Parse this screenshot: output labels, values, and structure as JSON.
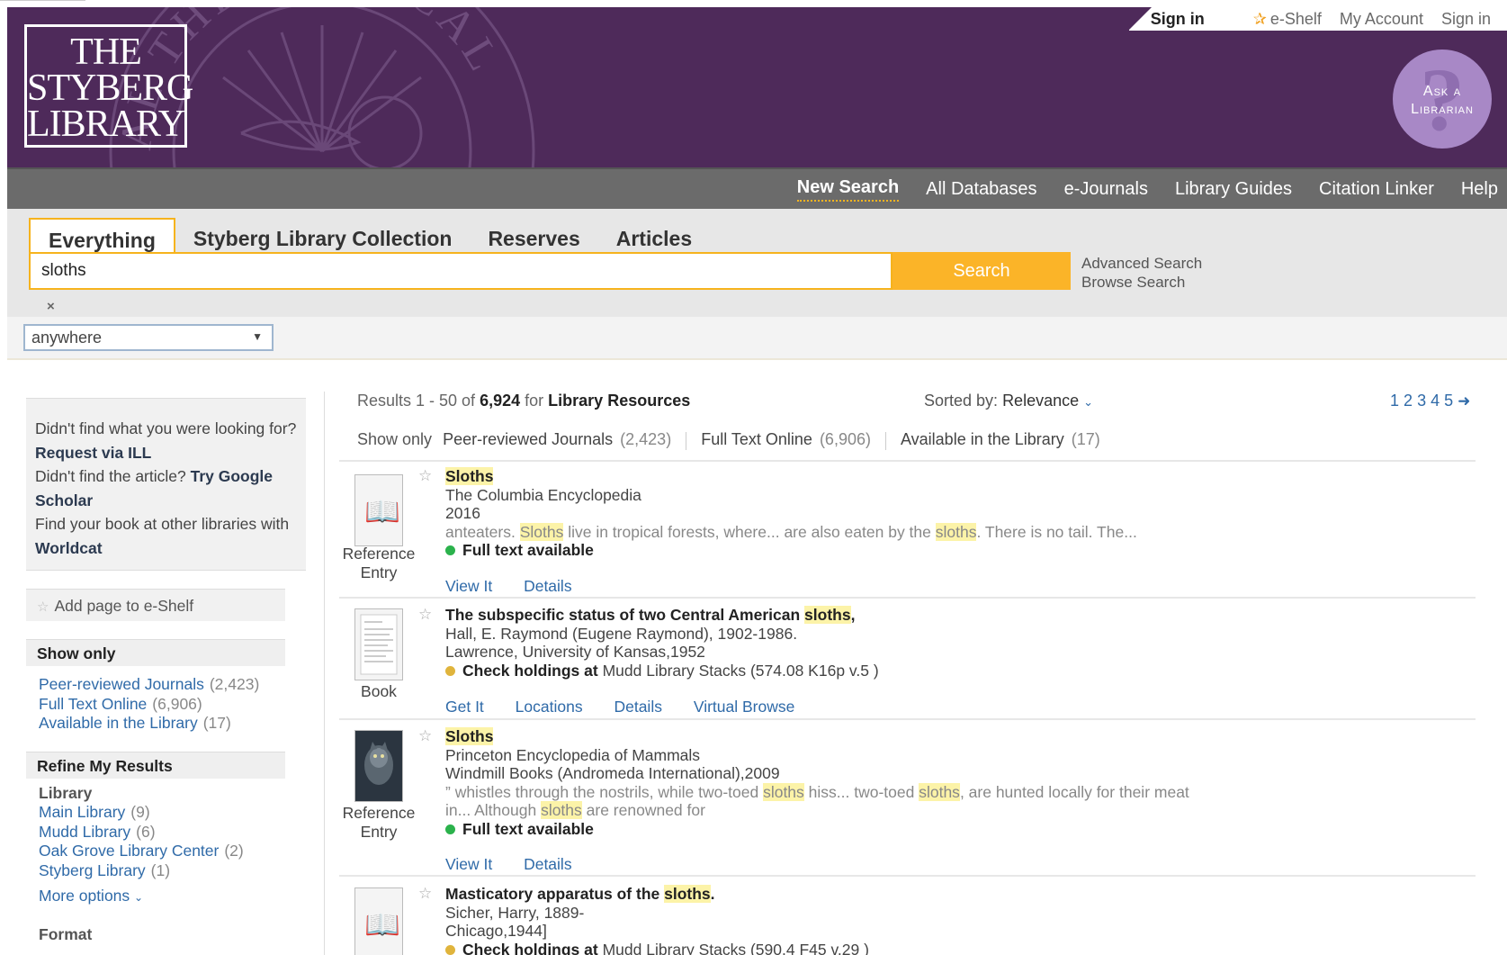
{
  "header": {
    "logo_lines": [
      "THE",
      "STYBERG",
      "LIBRARY"
    ],
    "seal_text": "AL THEOLOGICAL",
    "toplinks": {
      "signin_bold": "Sign in",
      "eshelf": "e-Shelf",
      "my_account": "My Account",
      "signin": "Sign in"
    },
    "ask_a_librarian": [
      "Ask a",
      "Librarian"
    ]
  },
  "nav": {
    "items": [
      "New Search",
      "All Databases",
      "e-Journals",
      "Library Guides",
      "Citation Linker",
      "Help"
    ]
  },
  "search": {
    "tabs": [
      "Everything",
      "Styberg Library Collection",
      "Reserves",
      "Articles"
    ],
    "query": "sloths",
    "button": "Search",
    "advanced": "Advanced Search",
    "browse": "Browse Search",
    "clear": "×",
    "scope": "anywhere"
  },
  "sidebar": {
    "ill": {
      "t1": "Didn't find what you were looking for?",
      "l1": "Request via ILL",
      "t2": "Didn't find the article?",
      "l2": "Try Google Scholar",
      "t3": "Find your book at other libraries with",
      "l3": "Worldcat"
    },
    "add_page": "Add page to e-Shelf",
    "show_only_title": "Show only",
    "show_only": [
      {
        "label": "Peer-reviewed Journals",
        "count": "(2,423)"
      },
      {
        "label": "Full Text Online",
        "count": "(6,906)"
      },
      {
        "label": "Available in the Library",
        "count": "(17)"
      }
    ],
    "refine_title": "Refine My Results",
    "library_group": "Library",
    "libraries": [
      {
        "label": "Main Library",
        "count": "(9)"
      },
      {
        "label": "Mudd Library",
        "count": "(6)"
      },
      {
        "label": "Oak Grove Library Center",
        "count": "(2)"
      },
      {
        "label": "Styberg Library",
        "count": "(1)"
      }
    ],
    "more_options": "More options",
    "format_group": "Format"
  },
  "results": {
    "prefix": "Results 1 - 50 of",
    "total": "6,924",
    "for": "for",
    "scope": "Library Resources",
    "sorted_label": "Sorted by:",
    "sorted_value": "Relevance",
    "pages": [
      "1",
      "2",
      "3",
      "4",
      "5"
    ],
    "showonly_label": "Show only",
    "filters": [
      {
        "label": "Peer-reviewed Journals",
        "count": "(2,423)"
      },
      {
        "label": "Full Text Online",
        "count": "(6,906)"
      },
      {
        "label": "Available in the Library",
        "count": "(17)"
      }
    ],
    "records": [
      {
        "type": [
          "Reference",
          "Entry"
        ],
        "title": "Sloths",
        "line1": "The Columbia Encyclopedia",
        "line2": "2016",
        "snippet": [
          "anteaters. ",
          "Sloths",
          " live in tropical forests, where... are also eaten by the ",
          "sloths",
          ". There is no tail. The..."
        ],
        "availability": "Full text available",
        "actions": [
          "View It",
          "Details"
        ]
      },
      {
        "type": [
          "Book"
        ],
        "title_a": "The subspecific status of two Central American ",
        "title_b": "sloths",
        "title_c": ",",
        "line1": "Hall, E. Raymond (Eugene Raymond), 1902-1986.",
        "line2": "Lawrence, University of Kansas,1952",
        "availability_bold": "Check holdings at",
        "availability_rest": "Mudd Library Stacks (574.08 K16p v.5 )",
        "actions": [
          "Get It",
          "Locations",
          "Details",
          "Virtual Browse"
        ]
      },
      {
        "type": [
          "Reference",
          "Entry"
        ],
        "title": "Sloths",
        "line1": "Princeton Encyclopedia of Mammals",
        "line2": "Windmill Books (Andromeda International),2009",
        "snippet1": [
          "” whistles through the nostrils, while two-toed ",
          "sloths",
          " hiss... two-toed ",
          "sloths",
          ", are hunted locally for their meat"
        ],
        "snippet2": [
          "in... Although ",
          "sloths",
          " are renowned for"
        ],
        "availability": "Full text available",
        "actions": [
          "View It",
          "Details"
        ]
      },
      {
        "title_a": "Masticatory apparatus of the ",
        "title_b": "sloths",
        "title_c": ".",
        "line1": "Sicher, Harry, 1889-",
        "line2": "Chicago,1944]",
        "availability_bold": "Check holdings at",
        "availability_rest": "Mudd Library Stacks (590.4 F45 v.29 )"
      }
    ]
  },
  "colors": {
    "header_purple": "#4e2a5a",
    "accent_gold": "#fbb428",
    "link_blue": "#2f6aa8",
    "dot_green": "#2bb24c",
    "dot_gold": "#e0b43c"
  }
}
